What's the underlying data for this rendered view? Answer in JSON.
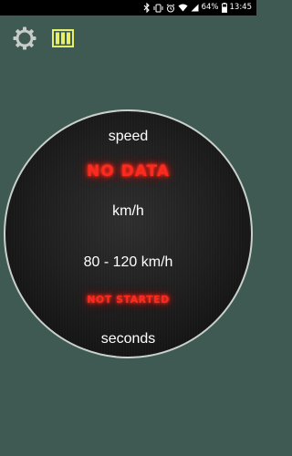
{
  "status_bar": {
    "bluetooth_icon": "bluetooth-icon",
    "vibrate_icon": "vibrate-icon",
    "alarm_icon": "alarm-icon",
    "wifi_icon": "wifi-icon",
    "signal_icon": "signal-icon",
    "battery_percent": "64%",
    "battery_icon": "battery-icon",
    "time": "13:45"
  },
  "toolbar": {
    "settings_icon": "gear-icon",
    "results_icon": "columns-icon",
    "settings_color": "#c8ccc9",
    "results_color": "#e6f06e"
  },
  "dial": {
    "speed_label": "speed",
    "speed_value": "NO DATA",
    "speed_unit": "km/h",
    "range_label": "80 - 120 km/h",
    "timer_status": "NOT STARTED",
    "timer_unit": "seconds"
  },
  "colors": {
    "background": "#3f5a52",
    "glow_red": "#ff2a1e",
    "dial_border": "#c9d0cc"
  }
}
